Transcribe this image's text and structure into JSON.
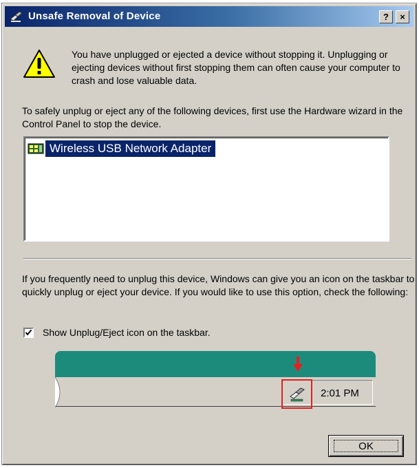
{
  "window": {
    "title": "Unsafe Removal of Device",
    "help_button": "?",
    "close_button": "×"
  },
  "warning_text": "You have unplugged or ejected a device without stopping it. Unplugging or ejecting devices without first stopping them can often cause your computer to crash and lose valuable data.",
  "instruction_text": "To safely unplug or eject any of the following devices, first use the Hardware wizard in the Control Panel to stop the device.",
  "device_list": {
    "items": [
      {
        "label": "Wireless USB Network Adapter",
        "icon": "network-adapter-icon",
        "selected": true
      }
    ]
  },
  "frequent_text": "If you frequently need to unplug this device, Windows can give you an icon on the taskbar to quickly unplug or eject your device. If you would like to use this option, check the following:",
  "show_icon_option": {
    "label": "Show Unplug/Eject icon on the taskbar.",
    "checked": true
  },
  "taskbar_preview": {
    "clock": "2:01 PM",
    "tray_icon": "unplug-eject-icon"
  },
  "buttons": {
    "ok_label": "OK"
  },
  "colors": {
    "title_bar": "#0a246a",
    "selection": "#0a246a",
    "taskbar_accent": "#1d8b7c",
    "highlight": "#e32020"
  }
}
